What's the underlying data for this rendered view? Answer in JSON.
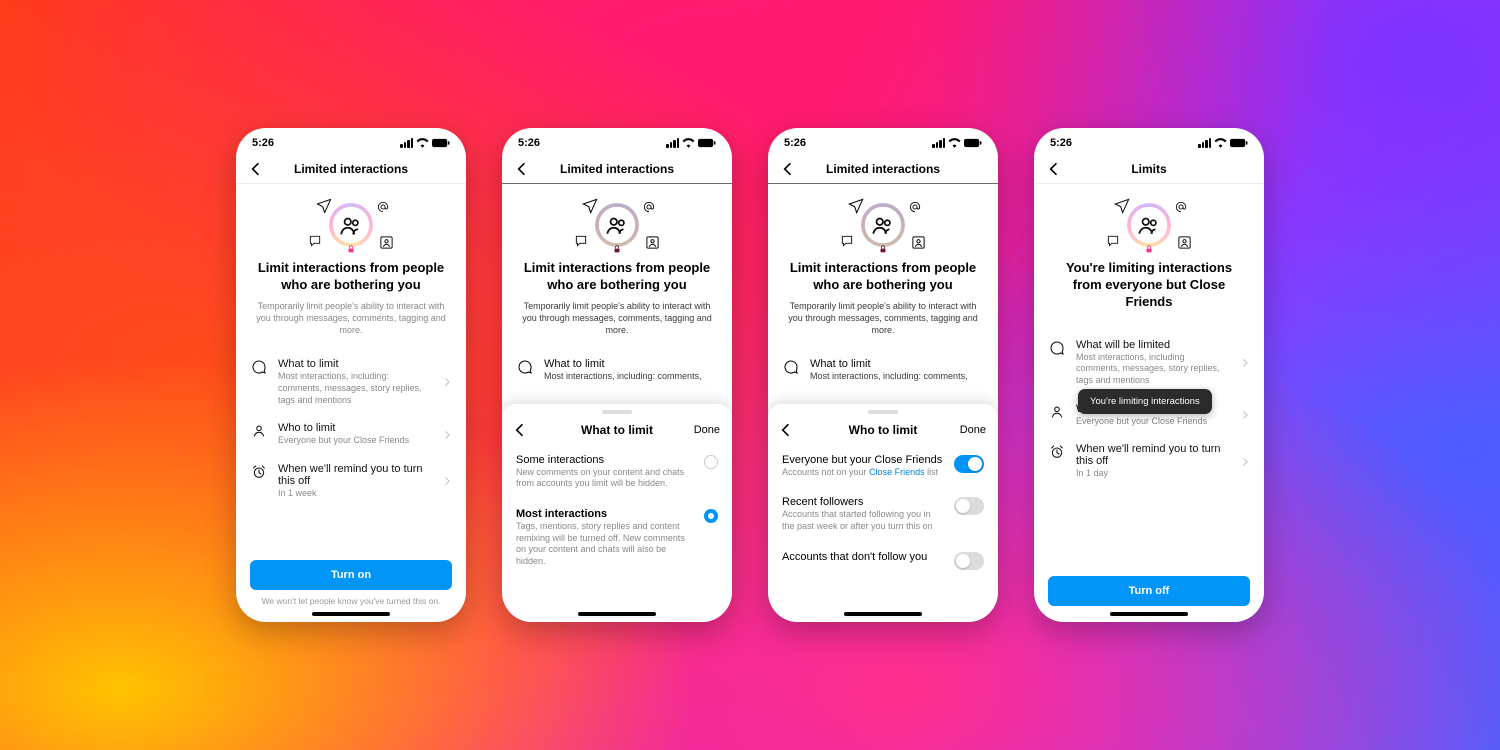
{
  "status_time": "5:26",
  "devices": [
    {
      "nav_title": "Limited interactions",
      "hero": {
        "heading": "Limit interactions from people who are bothering you",
        "body": "Temporarily limit people's ability to interact with you through messages, comments, tagging and more."
      },
      "rows": [
        {
          "title": "What to limit",
          "sub": "Most interactions, including: comments, messages, story replies, tags and mentions"
        },
        {
          "title": "Who to limit",
          "sub": "Everyone but your Close Friends"
        },
        {
          "title": "When we'll remind you to turn this off",
          "sub": "In 1 week"
        }
      ],
      "cta": "Turn on",
      "cta_note": "We won't let people know you've turned this on."
    },
    {
      "dim": {
        "nav_title": "Limited interactions",
        "heading": "Limit interactions from people who are bothering you",
        "body": "Temporarily limit people's ability to interact with you through messages, comments, tagging and more.",
        "peek_title": "What to limit",
        "peek_sub": "Most interactions, including: comments,"
      },
      "sheet": {
        "title": "What to limit",
        "done": "Done",
        "options": [
          {
            "title": "Some interactions",
            "sub": "New comments on your content and chats from accounts you limit will be hidden.",
            "selected": false,
            "bold": false
          },
          {
            "title": "Most interactions",
            "sub": "Tags, mentions, story replies and content remixing will be turned off. New comments on your content and chats will also be hidden.",
            "selected": true,
            "bold": true
          }
        ]
      }
    },
    {
      "dim": {
        "nav_title": "Limited interactions",
        "heading": "Limit interactions from people who are bothering you",
        "body": "Temporarily limit people's ability to interact with you through messages, comments, tagging and more.",
        "peek_title": "What to limit",
        "peek_sub": "Most interactions, including: comments,"
      },
      "sheet": {
        "title": "Who to limit",
        "done": "Done",
        "toggles": [
          {
            "title": "Everyone but your Close Friends",
            "sub_pre": "Accounts not on your ",
            "sub_link": "Close Friends",
            "sub_post": " list",
            "on": true
          },
          {
            "title": "Recent followers",
            "sub": "Accounts that started following you in the past week or after you turn this on",
            "on": false
          },
          {
            "title": "Accounts that don't follow you",
            "sub": "",
            "on": false
          }
        ]
      }
    },
    {
      "nav_title": "Limits",
      "hero": {
        "heading": "You're limiting interactions from everyone but Close Friends"
      },
      "rows": [
        {
          "title": "What will be limited",
          "sub": "Most interactions, including comments, messages, story replies, tags and mentions"
        },
        {
          "title": "Who to limit",
          "sub": "Everyone but your Close Friends"
        },
        {
          "title": "When we'll remind you to turn this off",
          "sub": "In 1 day"
        }
      ],
      "toast": "You're limiting interactions",
      "cta": "Turn off"
    }
  ]
}
